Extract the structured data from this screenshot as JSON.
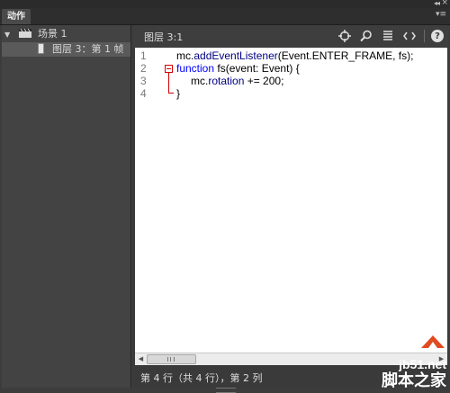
{
  "window": {
    "collapse_glyph": "◂◂",
    "close_glyph": "×",
    "panel_menu_glyph": "▾≡"
  },
  "tab": {
    "label": "动作"
  },
  "tree": {
    "scene_label": "场景 1",
    "layer_label": "图层 3：第 1 帧"
  },
  "editor": {
    "title": "图层 3:1",
    "toolbar_icons": [
      "target-icon",
      "search-icon",
      "format-code-icon",
      "code-brackets-icon",
      "help-icon"
    ],
    "line_numbers": [
      "1",
      "2",
      "3",
      "4"
    ],
    "code": {
      "line1_a": "mc.",
      "line1_b": "addEventListener",
      "line1_c": "(Event.ENTER_FRAME, fs);",
      "line2_kw": "function",
      "line2_rest": " fs(event: Event) {",
      "line3_a": "mc.",
      "line3_b": "rotation",
      "line3_c": " += 200;",
      "line4": "}"
    },
    "hscroll_grip": "|||"
  },
  "status": {
    "text": "第 4 行（共 4 行），第 2 列"
  },
  "watermark": {
    "url": "jb51.net",
    "text": "脚本之家"
  },
  "colors": {
    "keyword": "#0000ff",
    "fold_marker": "#d40000",
    "watermark_bg": "#e04b20"
  }
}
